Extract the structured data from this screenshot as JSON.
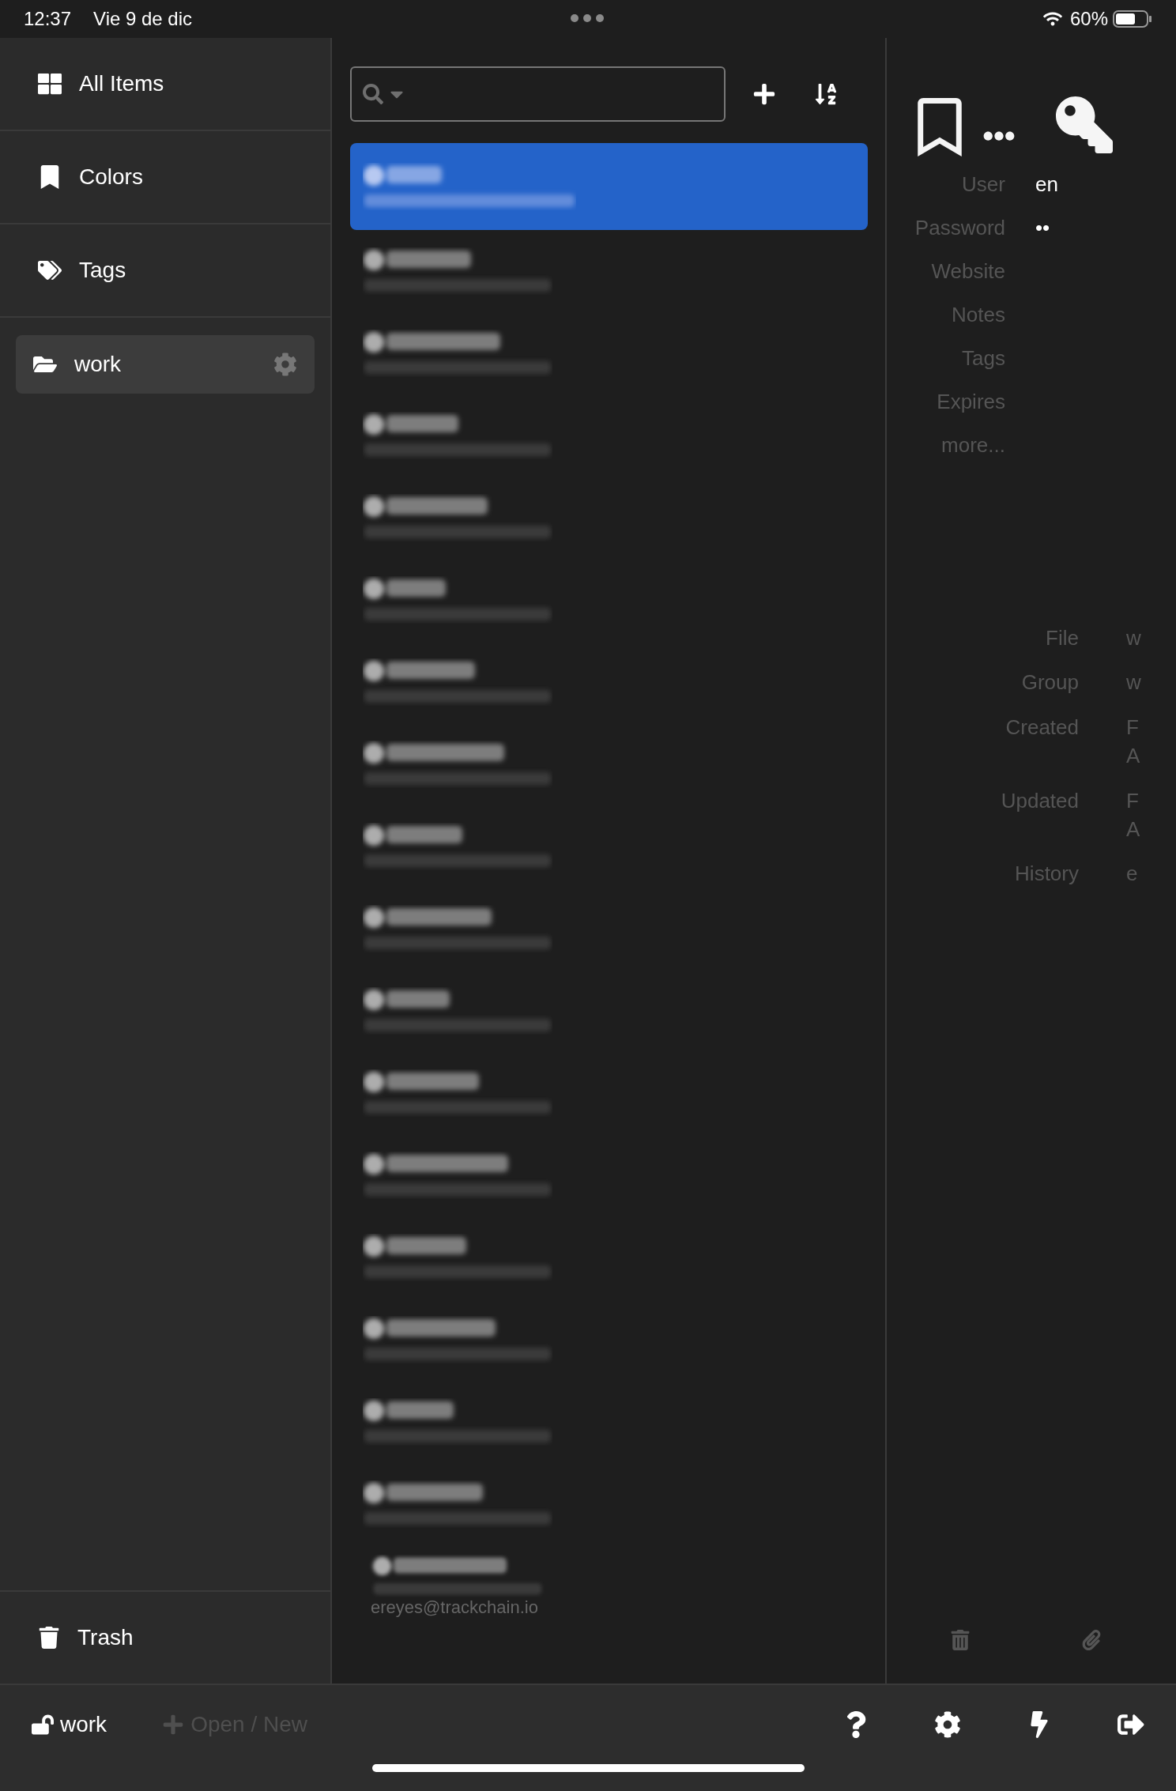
{
  "status_bar": {
    "time": "12:37",
    "date": "Vie 9 de dic",
    "battery": "60%"
  },
  "sidebar": {
    "items": [
      {
        "label": "All Items",
        "kind": "grid",
        "selected": false
      },
      {
        "label": "Colors",
        "kind": "bookmark",
        "selected": false
      },
      {
        "label": "Tags",
        "kind": "tags",
        "selected": false
      },
      {
        "label": "work",
        "kind": "folder",
        "selected": true
      }
    ],
    "trash": {
      "label": "Trash"
    }
  },
  "entries": [
    {
      "selected": true
    },
    {
      "selected": false
    },
    {
      "selected": false
    },
    {
      "selected": false
    },
    {
      "selected": false
    },
    {
      "selected": false
    },
    {
      "selected": false
    },
    {
      "selected": false
    },
    {
      "selected": false
    },
    {
      "selected": false
    },
    {
      "selected": false
    },
    {
      "selected": false
    },
    {
      "selected": false
    },
    {
      "selected": false
    },
    {
      "selected": false
    },
    {
      "selected": false
    },
    {
      "selected": false
    },
    {
      "selected": false,
      "subtitle": "ereyes@trackchain.io"
    }
  ],
  "details": {
    "fields": [
      {
        "label": "User",
        "value": "en"
      },
      {
        "label": "Password",
        "value": "••"
      },
      {
        "label": "Website"
      },
      {
        "label": "Notes"
      },
      {
        "label": "Tags"
      },
      {
        "label": "Expires"
      },
      {
        "label": "more..."
      }
    ],
    "meta": [
      {
        "label": "File",
        "value": "w"
      },
      {
        "label": "Group",
        "value": "w"
      },
      {
        "label": "Created",
        "value": "F\nA"
      },
      {
        "label": "Updated",
        "value": "F\nA"
      },
      {
        "label": "History",
        "value": "e"
      }
    ]
  },
  "footer": {
    "file": "work",
    "open": "Open / New"
  }
}
